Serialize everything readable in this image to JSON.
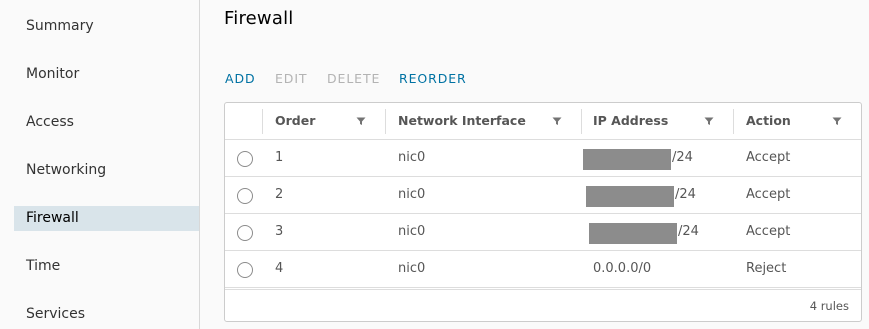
{
  "sidebar": {
    "items": [
      {
        "label": "Summary",
        "active": false
      },
      {
        "label": "Monitor",
        "active": false
      },
      {
        "label": "Access",
        "active": false
      },
      {
        "label": "Networking",
        "active": false
      },
      {
        "label": "Firewall",
        "active": true
      },
      {
        "label": "Time",
        "active": false
      },
      {
        "label": "Services",
        "active": false
      }
    ]
  },
  "page": {
    "title": "Firewall"
  },
  "toolbar": {
    "add": "ADD",
    "edit": "EDIT",
    "delete": "DELETE",
    "reorder": "REORDER"
  },
  "grid": {
    "columns": [
      "Order",
      "Network Interface",
      "IP Address",
      "Action"
    ],
    "rows": [
      {
        "order": "1",
        "interface": "nic0",
        "ip": "/24",
        "ip_redacted": true,
        "action": "Accept"
      },
      {
        "order": "2",
        "interface": "nic0",
        "ip": "/24",
        "ip_redacted": true,
        "action": "Accept"
      },
      {
        "order": "3",
        "interface": "nic0",
        "ip": "/24",
        "ip_redacted": true,
        "action": "Accept"
      },
      {
        "order": "4",
        "interface": "nic0",
        "ip": "0.0.0.0/0",
        "ip_redacted": false,
        "action": "Reject"
      }
    ],
    "footer": "4 rules"
  },
  "colors": {
    "accent": "#0072a3",
    "active_nav": "#d9e4ea",
    "redaction": "#8c8c8c"
  }
}
